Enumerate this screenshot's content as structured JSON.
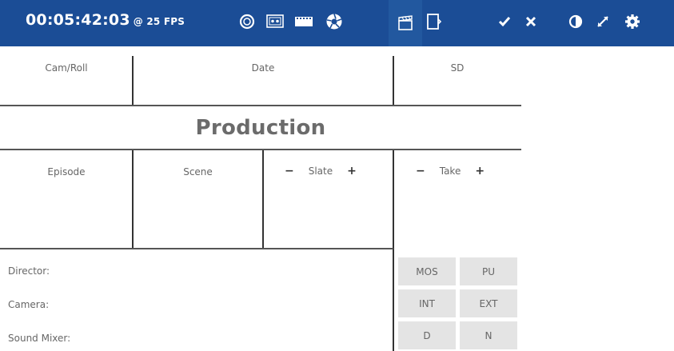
{
  "toolbar": {
    "timecode": "00:05:42:03",
    "fps": "@ 25 FPS",
    "icons": [
      "sync-icon",
      "monitor-icon",
      "film-strip-icon",
      "aperture-icon",
      "clapperboard-icon",
      "export-icon",
      "check-icon",
      "close-icon",
      "contrast-icon",
      "expand-icon",
      "gear-icon"
    ],
    "active_icon": "clapperboard-icon",
    "bg_color": "#1b4d96"
  },
  "slate": {
    "row1": {
      "cam_roll": "Cam/Roll",
      "date": "Date",
      "sd": "SD"
    },
    "title": "Production",
    "row2": {
      "episode": "Episode",
      "scene": "Scene",
      "slate": "Slate",
      "take": "Take",
      "minus": "−",
      "plus": "+"
    },
    "crew": {
      "director": "Director:",
      "camera": "Camera:",
      "sound_mixer": "Sound Mixer:"
    },
    "flags": {
      "mos": "MOS",
      "pu": "PU",
      "int": "INT",
      "ext": "EXT",
      "d": "D",
      "n": "N"
    }
  }
}
